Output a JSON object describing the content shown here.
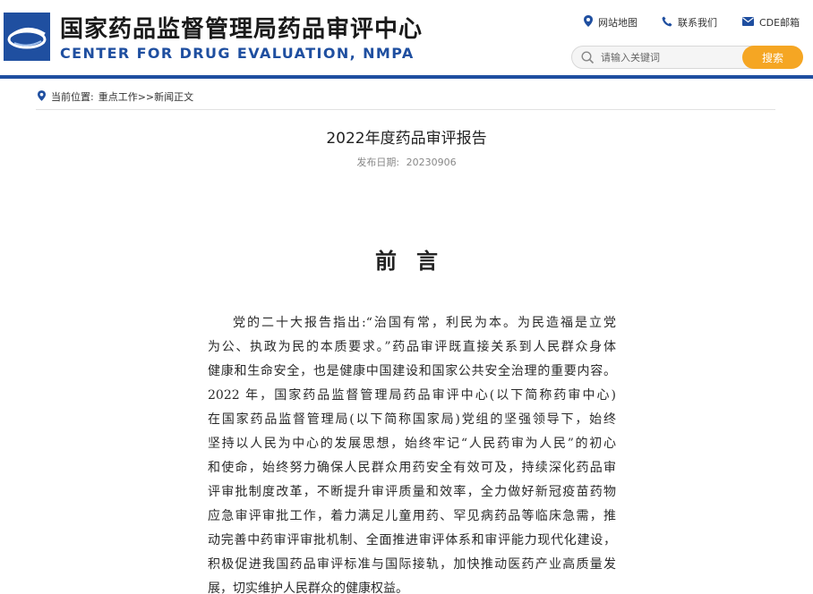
{
  "header": {
    "title_cn": "国家药品监督管理局药品审评中心",
    "title_en": "CENTER FOR DRUG EVALUATION, NMPA",
    "brand_color": "#1f4fa0",
    "links": [
      {
        "label": "网站地图",
        "icon": "map-pin-icon"
      },
      {
        "label": "联系我们",
        "icon": "phone-icon"
      },
      {
        "label": "CDE邮箱",
        "icon": "mail-icon"
      }
    ],
    "search": {
      "placeholder": "请输入关键词",
      "button_label": "搜索",
      "button_color": "#f5a623"
    }
  },
  "breadcrumb": {
    "prefix": "当前位置:",
    "items": [
      "重点工作",
      ">>",
      "新闻正文"
    ]
  },
  "article": {
    "title": "2022年度药品审评报告",
    "date_label": "发布日期:",
    "date_value": "20230906"
  },
  "document": {
    "heading": "前言",
    "lines": [
      "党的二十大报告指出:“治国有常，利民为本。为民造福是立党",
      "为公、执政为民的本质要求。”药品审评既直接关系到人民群众身体",
      "健康和生命安全，也是健康中国建设和国家公共安全治理的重要内容。",
      "2022 年，国家药品监督管理局药品审评中心(以下简称药审中心)",
      "在国家药品监督管理局(以下简称国家局)党组的坚强领导下，始终",
      "坚持以人民为中心的发展思想，始终牢记“人民药审为人民”的初心",
      "和使命，始终努力确保人民群众用药安全有效可及，持续深化药品审",
      "评审批制度改革，不断提升审评质量和效率，全力做好新冠疫苗药物",
      "应急审评审批工作，着力满足儿童用药、罕见病药品等临床急需，推",
      "动完善中药审评审批机制、全面推进审评体系和审评能力现代化建设，",
      "积极促进我国药品审评标准与国际接轨，加快推动医药产业高质量发",
      "展，切实维护人民群众的健康权益。"
    ]
  }
}
